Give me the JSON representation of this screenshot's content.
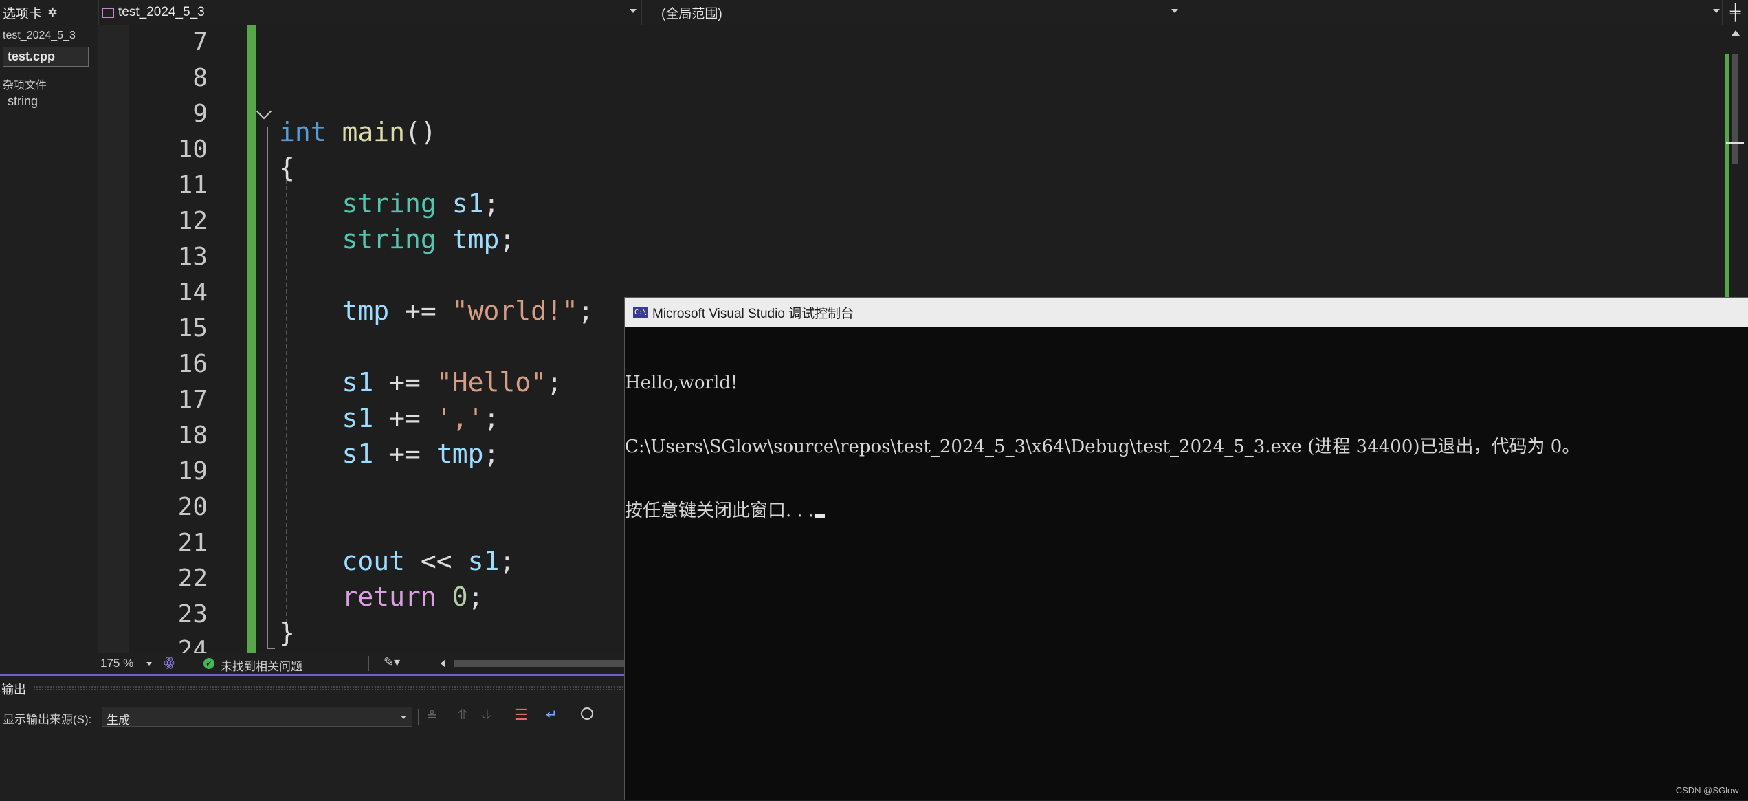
{
  "top_bar": {
    "tabs_label": "选项卡",
    "project_dropdown": "test_2024_5_3",
    "scope_dropdown": "(全局范围)",
    "member_dropdown": ""
  },
  "left_panel": {
    "project_name": "test_2024_5_3",
    "active_file": "test.cpp",
    "misc_group": "杂项文件",
    "misc_file": "string"
  },
  "editor": {
    "line_numbers": [
      "7",
      "8",
      "9",
      "10",
      "11",
      "12",
      "13",
      "14",
      "15",
      "16",
      "17",
      "18",
      "19",
      "20",
      "21",
      "22",
      "23",
      "24"
    ]
  },
  "status_row": {
    "zoom": "175 %",
    "issues": "未找到相关问题"
  },
  "output_panel": {
    "title": "输出",
    "source_label": "显示输出来源(S):",
    "source_value": "生成"
  },
  "console": {
    "title": "Microsoft Visual Studio 调试控制台",
    "icon_text": "C:\\",
    "lines": [
      "Hello,world!",
      "C:\\Users\\SGlow\\source\\repos\\test_2024_5_3\\x64\\Debug\\test_2024_5_3.exe (进程 34400)已退出，代码为 0。",
      "按任意键关闭此窗口. . ."
    ]
  },
  "watermark": "CSDN @SGlow-",
  "colors": {
    "keyword": "#569cd6",
    "type": "#4ec9b0",
    "function": "#dcdcaa",
    "variable": "#9cdcfe",
    "string": "#d69d85",
    "number": "#b5cea8",
    "control": "#d8a0df",
    "change_bar": "#57a64a",
    "panel_accent": "#7160c8"
  }
}
